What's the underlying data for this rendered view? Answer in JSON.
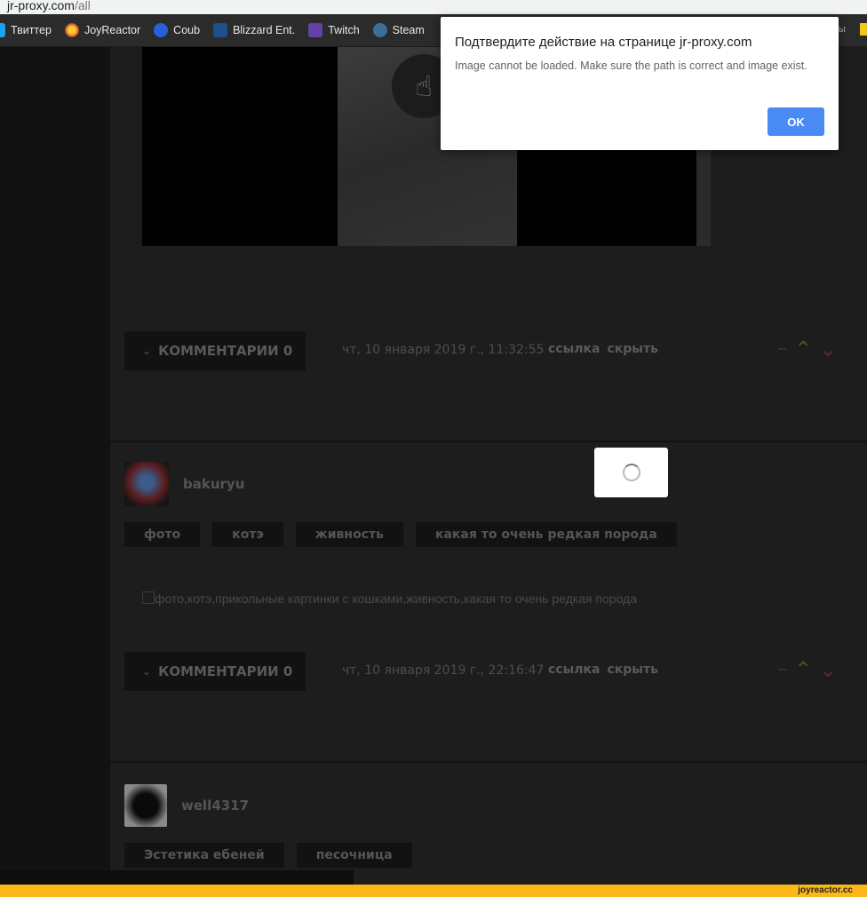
{
  "browser": {
    "url_host": "jr-proxy.com",
    "url_path": "/all",
    "bookmarks": [
      {
        "label": "Твиттер",
        "icon": "twitter-icon",
        "color": "#1da1f2"
      },
      {
        "label": "JoyReactor",
        "icon": "joyreactor-icon",
        "color": "#e0a020"
      },
      {
        "label": "Coub",
        "icon": "coub-icon",
        "color": "#2b5fd9"
      },
      {
        "label": "Blizzard Ent.",
        "icon": "blizzard-icon",
        "color": "#1e4f8a"
      },
      {
        "label": "Twitch",
        "icon": "twitch-icon",
        "color": "#6441a5"
      },
      {
        "label": "Steam",
        "icon": "steam-icon",
        "color": "#1b2838"
      }
    ],
    "bookmark_tail": "ы"
  },
  "post1": {
    "comments_label": "КОММЕНТАРИИ 0",
    "date": "чт, 10 января 2019 г., 11:32:55",
    "link_label": "ссылка",
    "hide_label": "скрыть",
    "rating": "--"
  },
  "post2": {
    "username": "bakuryu",
    "tags": [
      "фото",
      "котэ",
      "живность",
      "какая то очень редкая порода"
    ],
    "image_alt": "фото,котэ,прикольные картинки с кошками,живность,какая то очень редкая порода",
    "comments_label": "КОММЕНТАРИИ 0",
    "date": "чт, 10 января 2019 г., 22:16:47",
    "link_label": "ссылка",
    "hide_label": "скрыть",
    "rating": "--"
  },
  "post3": {
    "username": "well4317",
    "tags": [
      "Эстетика ебеней",
      "песочница"
    ]
  },
  "dialog": {
    "title": "Подтвердите действие на странице jr-proxy.com",
    "message": "Image cannot be loaded. Make sure the path is correct and image exist.",
    "ok_label": "OK"
  },
  "footer": {
    "brand": "joyreactor.cc"
  },
  "colors": {
    "accent_yellow": "#fbb919",
    "ok_button": "#4a8af4"
  }
}
